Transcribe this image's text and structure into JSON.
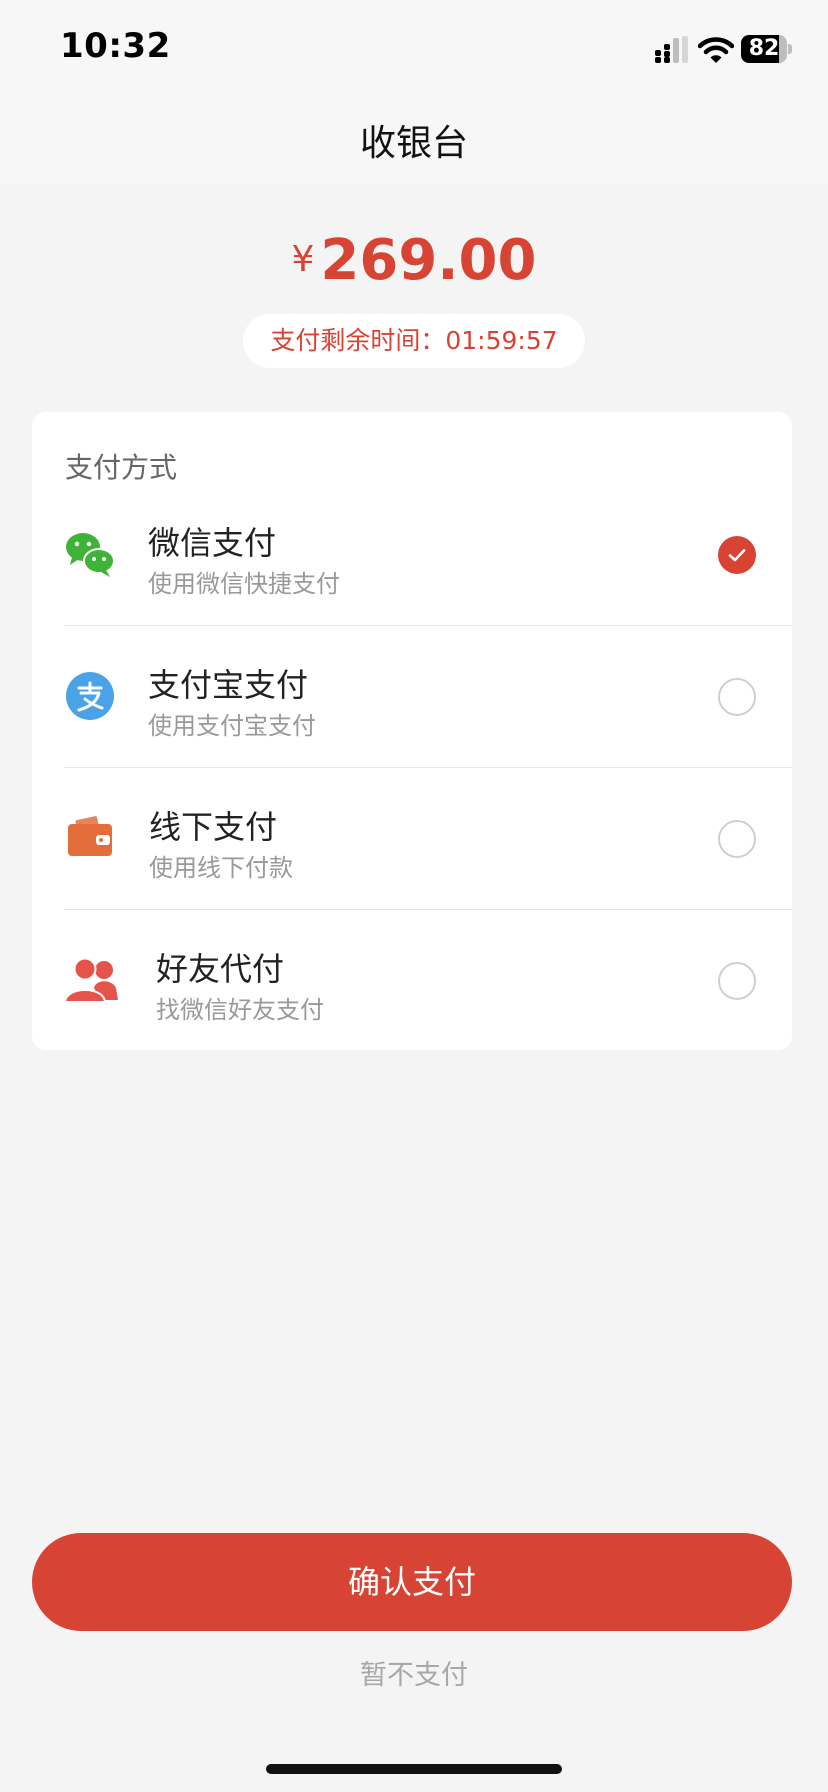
{
  "status_bar": {
    "time": "10:32",
    "battery_level": "82",
    "battery_fraction": 0.82
  },
  "nav": {
    "title": "收银台"
  },
  "payment": {
    "currency_symbol": "¥",
    "amount": "269.00",
    "countdown_text": "支付剩余时间：01:59:57"
  },
  "methods_section": {
    "title": "支付方式",
    "items": [
      {
        "name": "微信支付",
        "desc": "使用微信快捷支付",
        "icon": "wechat-icon",
        "selected": true
      },
      {
        "name": "支付宝支付",
        "desc": "使用支付宝支付",
        "icon": "alipay-icon",
        "selected": false
      },
      {
        "name": "线下支付",
        "desc": "使用线下付款",
        "icon": "wallet-icon",
        "selected": false
      },
      {
        "name": "好友代付",
        "desc": "找微信好友支付",
        "icon": "friends-icon",
        "selected": false
      }
    ]
  },
  "actions": {
    "confirm_label": "确认支付",
    "later_label": "暂不支付"
  },
  "colors": {
    "accent": "#d84434",
    "wechat": "#3fb337",
    "alipay": "#4aa3e6",
    "wallet": "#e36e3c",
    "friends": "#e5534b"
  }
}
